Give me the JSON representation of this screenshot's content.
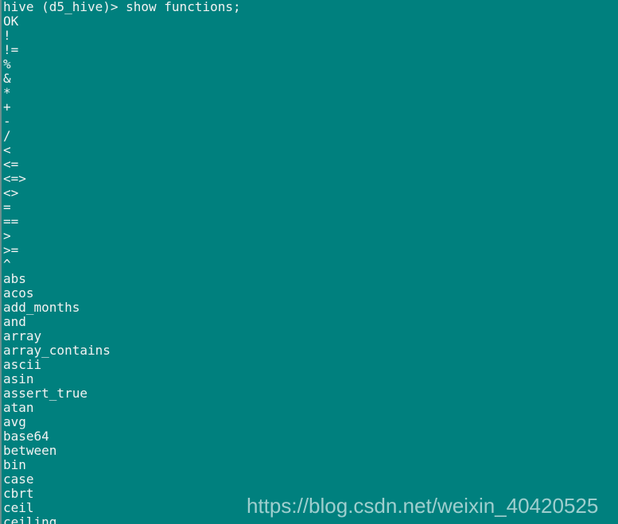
{
  "terminal": {
    "background_color": "#00807e",
    "text_color": "#f2f2f2",
    "prompt_line": "hive (d5_hive)> show functions;",
    "status_line": "OK",
    "lines": [
      "hive (d5_hive)> show functions;",
      "OK",
      "!",
      "!=",
      "%",
      "&",
      "*",
      "+",
      "-",
      "/",
      "<",
      "<=",
      "<=>",
      "<>",
      "=",
      "==",
      ">",
      ">=",
      "^",
      "abs",
      "acos",
      "add_months",
      "and",
      "array",
      "array_contains",
      "ascii",
      "asin",
      "assert_true",
      "atan",
      "avg",
      "base64",
      "between",
      "bin",
      "case",
      "cbrt",
      "ceil",
      "ceiling"
    ]
  },
  "watermark": {
    "text": "https://blog.csdn.net/weixin_40420525",
    "color": "#ffffff"
  }
}
